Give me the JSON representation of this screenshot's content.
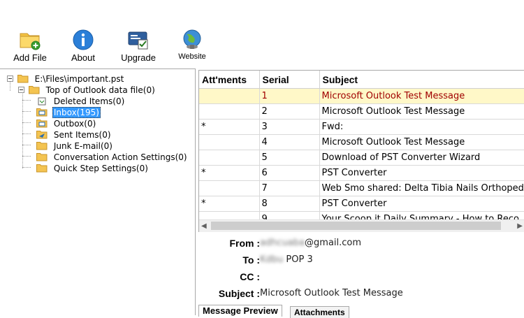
{
  "toolbar": {
    "add_file": "Add File",
    "about": "About",
    "upgrade": "Upgrade",
    "website": "Website"
  },
  "tree": {
    "root": "E:\\Files\\important.pst",
    "top": "Top of Outlook data file(0)",
    "folders": [
      "Deleted Items(0)",
      "Inbox(195)",
      "Outbox(0)",
      "Sent Items(0)",
      "Junk E-mail(0)",
      "Conversation Action Settings(0)",
      "Quick Step Settings(0)"
    ],
    "selected": "Inbox(195)"
  },
  "list": {
    "columns": [
      "Att'ments",
      "Serial",
      "Subject"
    ],
    "rows": [
      {
        "att": "",
        "serial": "1",
        "subject": "Microsoft Outlook Test Message"
      },
      {
        "att": "",
        "serial": "2",
        "subject": "Microsoft Outlook Test Message"
      },
      {
        "att": "*",
        "serial": "3",
        "subject": "Fwd:"
      },
      {
        "att": "",
        "serial": "4",
        "subject": "Microsoft Outlook Test Message"
      },
      {
        "att": "",
        "serial": "5",
        "subject": "Download of PST Converter Wizard"
      },
      {
        "att": "*",
        "serial": "6",
        "subject": "PST Converter"
      },
      {
        "att": "",
        "serial": "7",
        "subject": "Web Smo shared: Delta Tibia Nails Orthoped"
      },
      {
        "att": "*",
        "serial": "8",
        "subject": "PST Converter"
      },
      {
        "att": "",
        "serial": "9",
        "subject": "Your Scoop.it Daily Summary - How to Reco"
      }
    ]
  },
  "details": {
    "from_label": "From :",
    "from_blurred": "adhcuaba",
    "from_value": "@gmail.com",
    "to_label": "To :",
    "to_blurred": "Kdbu",
    "to_value": "POP 3",
    "cc_label": "CC :",
    "cc_value": "",
    "subject_label": "Subject :",
    "subject_value": "Microsoft Outlook Test Message"
  },
  "tabs": {
    "preview": "Message Preview",
    "attachments": "Attachments"
  },
  "colors": {
    "selection": "#3399ff",
    "selected_row_bg": "#fff8c8",
    "selected_row_text": "#a00000"
  }
}
